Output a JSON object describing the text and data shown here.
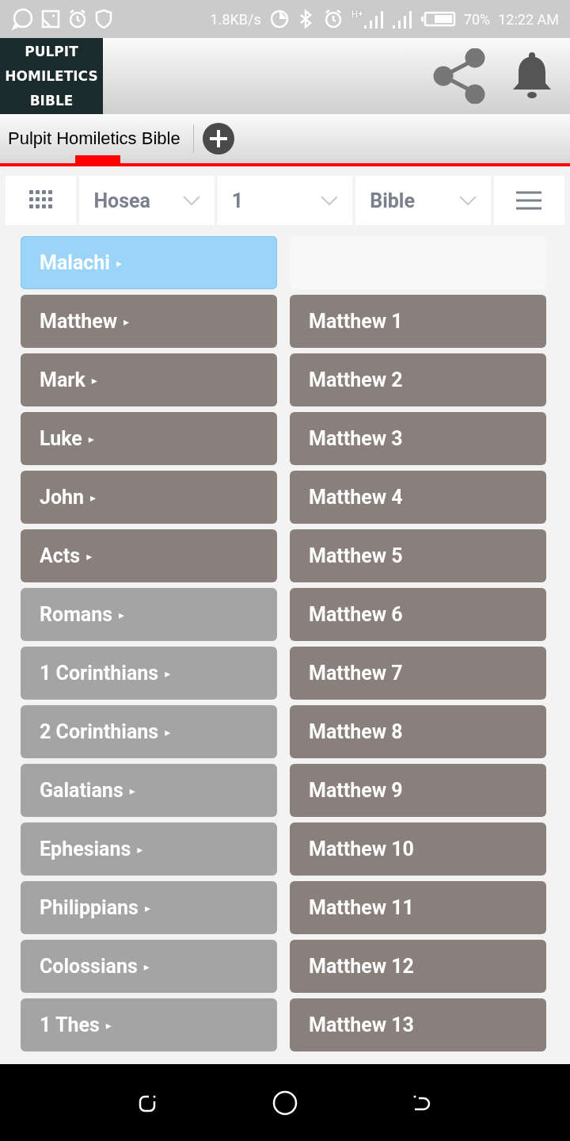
{
  "status_bar": {
    "speed": "1.8KB/s",
    "network": "H+",
    "battery": "70%",
    "time": "12:22 AM"
  },
  "header": {
    "logo_lines": [
      "PULPIT",
      "HOMILETICS",
      "BIBLE"
    ]
  },
  "tabs": [
    {
      "label": "Pulpit Homiletics Bible",
      "selected": true
    }
  ],
  "selectors": [
    {
      "value": "Hosea"
    },
    {
      "value": "1"
    },
    {
      "value": "Bible"
    }
  ],
  "books": [
    {
      "label": "Malachi",
      "marker": "▸",
      "selected": true,
      "color": "#9ad4f8"
    },
    {
      "label": "Matthew",
      "marker": "▸",
      "selected": false,
      "color": "#8a807b"
    },
    {
      "label": "Mark",
      "marker": "▸",
      "selected": false,
      "color": "#8a807b"
    },
    {
      "label": "Luke",
      "marker": "▸",
      "selected": false,
      "color": "#8a807b"
    },
    {
      "label": "John",
      "marker": "▸",
      "selected": false,
      "color": "#8a807b"
    },
    {
      "label": "Acts",
      "marker": "▸",
      "selected": false,
      "color": "#8a807b"
    },
    {
      "label": "Romans",
      "marker": "▸",
      "selected": false,
      "color": "#a4a4a4"
    },
    {
      "label": "1 Corinthians",
      "marker": "▸",
      "selected": false,
      "color": "#a4a4a4"
    },
    {
      "label": "2 Corinthians",
      "marker": "▸",
      "selected": false,
      "color": "#a4a4a4"
    },
    {
      "label": "Galatians",
      "marker": "▸",
      "selected": false,
      "color": "#a4a4a4"
    },
    {
      "label": "Ephesians",
      "marker": "▸",
      "selected": false,
      "color": "#a4a4a4"
    },
    {
      "label": "Philippians",
      "marker": "▸",
      "selected": false,
      "color": "#a4a4a4"
    },
    {
      "label": "Colossians",
      "marker": "▸",
      "selected": false,
      "color": "#a4a4a4"
    },
    {
      "label": "1 Thes",
      "marker": "▸",
      "selected": false,
      "color": "#a4a4a4"
    }
  ],
  "chapters": [
    {
      "kind": "blank"
    },
    {
      "kind": "chapter",
      "label": "Matthew 1"
    },
    {
      "kind": "chapter",
      "label": "Matthew 2"
    },
    {
      "kind": "chapter",
      "label": "Matthew 3"
    },
    {
      "kind": "chapter",
      "label": "Matthew 4"
    },
    {
      "kind": "chapter",
      "label": "Matthew 5"
    },
    {
      "kind": "chapter",
      "label": "Matthew 6"
    },
    {
      "kind": "chapter",
      "label": "Matthew 7"
    },
    {
      "kind": "chapter",
      "label": "Matthew 8"
    },
    {
      "kind": "chapter",
      "label": "Matthew 9"
    },
    {
      "kind": "chapter",
      "label": "Matthew 10"
    },
    {
      "kind": "chapter",
      "label": "Matthew 11"
    },
    {
      "kind": "chapter",
      "label": "Matthew 12"
    },
    {
      "kind": "chapter",
      "label": "Matthew 13"
    }
  ]
}
